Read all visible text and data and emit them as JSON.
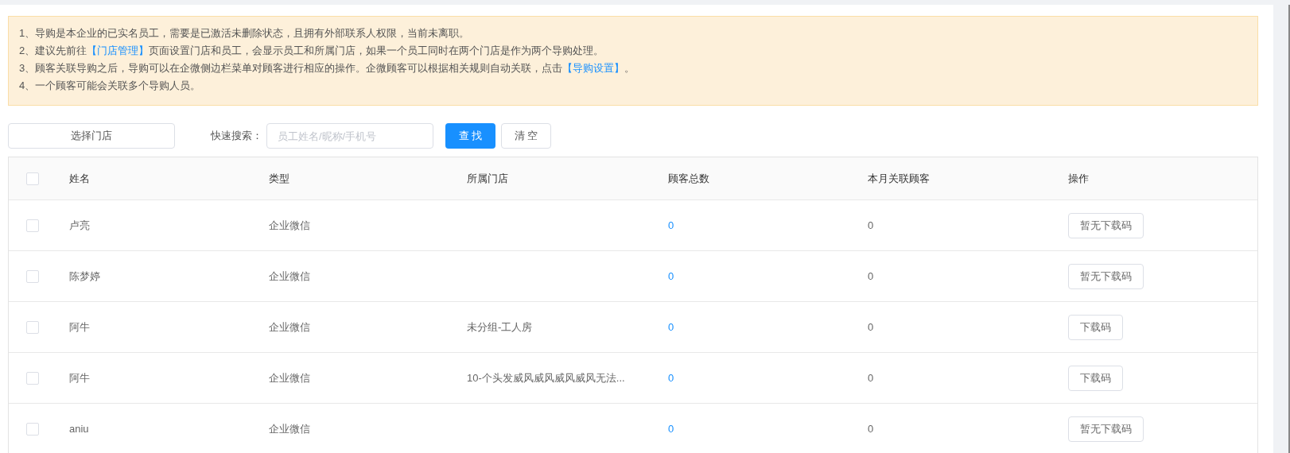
{
  "notice": [
    {
      "parts": [
        {
          "text": "1、导购是本企业的已实名员工，需要是已激活未删除状态，且拥有外部联系人权限，当前未离职。",
          "link": false
        }
      ]
    },
    {
      "parts": [
        {
          "text": "2、建议先前往",
          "link": false
        },
        {
          "text": "【门店管理】",
          "link": true
        },
        {
          "text": "页面设置门店和员工，会显示员工和所属门店，如果一个员工同时在两个门店是作为两个导购处理。",
          "link": false
        }
      ]
    },
    {
      "parts": [
        {
          "text": "3、顾客关联导购之后，导购可以在企微侧边栏菜单对顾客进行相应的操作。企微顾客可以根据相关规则自动关联，点击",
          "link": false
        },
        {
          "text": "【导购设置】",
          "link": true
        },
        {
          "text": "。",
          "link": false
        }
      ]
    },
    {
      "parts": [
        {
          "text": "4、一个顾客可能会关联多个导购人员。",
          "link": false
        }
      ]
    }
  ],
  "toolbar": {
    "store_button": "选择门店",
    "search_label": "快速搜索：",
    "search": {
      "placeholder": "员工姓名/昵称/手机号"
    },
    "find_button": "查 找",
    "clear_button": "清 空"
  },
  "table": {
    "select_all": {
      "checked": false
    },
    "columns": [
      "姓名",
      "类型",
      "所属门店",
      "顾客总数",
      "本月关联顾客",
      "操作"
    ],
    "rows": [
      {
        "checked": false,
        "name": "卢亮",
        "type": "企业微信",
        "store": "",
        "total": "0",
        "month": "0",
        "action": "暂无下载码"
      },
      {
        "checked": false,
        "name": "陈梦婷",
        "type": "企业微信",
        "store": "",
        "total": "0",
        "month": "0",
        "action": "暂无下载码"
      },
      {
        "checked": false,
        "name": "阿牛",
        "type": "企业微信",
        "store": "未分组-工人房",
        "total": "0",
        "month": "0",
        "action": "下载码"
      },
      {
        "checked": false,
        "name": "阿牛",
        "type": "企业微信",
        "store": "10-个头发威风威风威风威风无法...",
        "total": "0",
        "month": "0",
        "action": "下载码"
      },
      {
        "checked": false,
        "name": "aniu",
        "type": "企业微信",
        "store": "",
        "total": "0",
        "month": "0",
        "action": "暂无下载码"
      }
    ]
  }
}
